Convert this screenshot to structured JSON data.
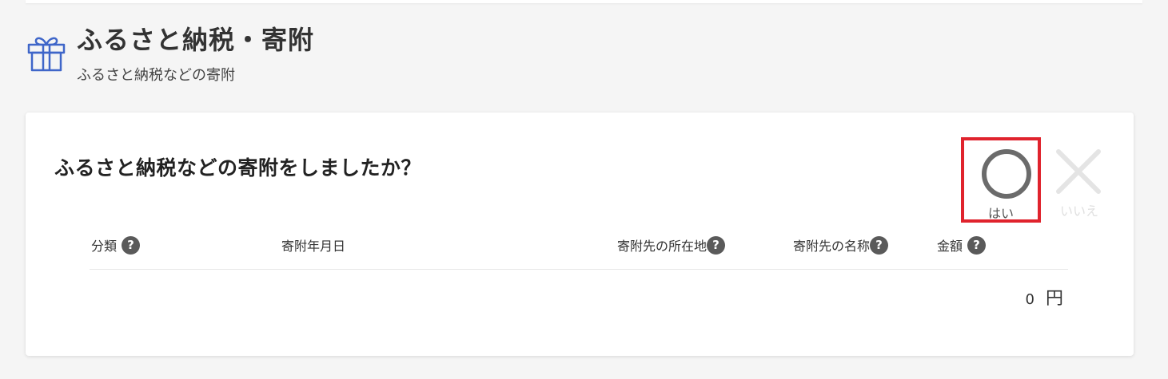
{
  "header": {
    "title": "ふるさと納税・寄附",
    "subtitle": "ふるさと納税などの寄附",
    "icon": "gift-icon"
  },
  "card": {
    "question": "ふるさと納税などの寄附をしましたか？",
    "yes_label": "はい",
    "no_label": "いいえ",
    "selected": "yes"
  },
  "table": {
    "columns": [
      {
        "label": "分類",
        "help": true
      },
      {
        "label": "寄附年月日",
        "help": false
      },
      {
        "label": "寄附先の所在地",
        "help": true
      },
      {
        "label": "寄附先の名称",
        "help": true
      },
      {
        "label": "金額",
        "help": true
      }
    ],
    "help_glyph": "?"
  },
  "total": {
    "value": "0",
    "unit": "円"
  },
  "colors": {
    "accent_blue": "#3f66c9",
    "selection_red": "#e0232d",
    "icon_gray": "#5a5a5a"
  }
}
